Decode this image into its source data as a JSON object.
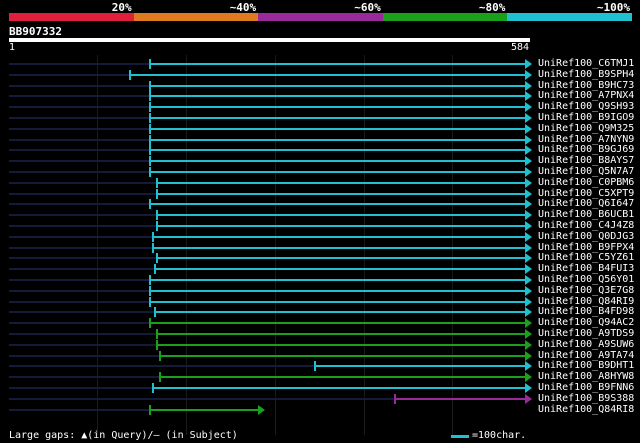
{
  "legend": {
    "labels": [
      "20%",
      "~40%",
      "~60%",
      "~80%",
      "~100%"
    ],
    "colors": [
      "#e0203a",
      "#e07a20",
      "#9a2a9a",
      "#1aa01a",
      "#20c0d0"
    ]
  },
  "query": {
    "id": "BB907332",
    "start": "1",
    "end": "584",
    "length": 584
  },
  "hits": [
    {
      "name": "UniRef100_C6TMJ1",
      "start": 160,
      "end": 584,
      "color": "#20c0d0"
    },
    {
      "name": "UniRef100_B9SPH4",
      "start": 137,
      "end": 584,
      "color": "#20c0d0"
    },
    {
      "name": "UniRef100_B9HC73",
      "start": 160,
      "end": 584,
      "color": "#20c0d0"
    },
    {
      "name": "UniRef100_A7PNX4",
      "start": 160,
      "end": 584,
      "color": "#20c0d0"
    },
    {
      "name": "UniRef100_Q9SH93",
      "start": 160,
      "end": 584,
      "color": "#20c0d0"
    },
    {
      "name": "UniRef100_B9IGO9",
      "start": 160,
      "end": 584,
      "color": "#20c0d0"
    },
    {
      "name": "UniRef100_Q9M325",
      "start": 160,
      "end": 584,
      "color": "#20c0d0"
    },
    {
      "name": "UniRef100_A7NYN9",
      "start": 160,
      "end": 584,
      "color": "#20c0d0"
    },
    {
      "name": "UniRef100_B9GJ69",
      "start": 160,
      "end": 584,
      "color": "#20c0d0"
    },
    {
      "name": "UniRef100_B8AYS7",
      "start": 160,
      "end": 584,
      "color": "#20c0d0"
    },
    {
      "name": "UniRef100_Q5N7A7",
      "start": 160,
      "end": 584,
      "color": "#20c0d0"
    },
    {
      "name": "UniRef100_C0PBM6",
      "start": 168,
      "end": 584,
      "color": "#20c0d0"
    },
    {
      "name": "UniRef100_C5XPT9",
      "start": 168,
      "end": 584,
      "color": "#20c0d0"
    },
    {
      "name": "UniRef100_Q6I647",
      "start": 160,
      "end": 584,
      "color": "#20c0d0"
    },
    {
      "name": "UniRef100_B6UCB1",
      "start": 168,
      "end": 584,
      "color": "#20c0d0"
    },
    {
      "name": "UniRef100_C4J4Z8",
      "start": 168,
      "end": 584,
      "color": "#20c0d0"
    },
    {
      "name": "UniRef100_Q0DJG3",
      "start": 163,
      "end": 584,
      "color": "#20c0d0"
    },
    {
      "name": "UniRef100_B9FPX4",
      "start": 163,
      "end": 584,
      "color": "#20c0d0"
    },
    {
      "name": "UniRef100_C5YZ61",
      "start": 168,
      "end": 584,
      "color": "#20c0d0"
    },
    {
      "name": "UniRef100_B4FUI3",
      "start": 165,
      "end": 584,
      "color": "#20c0d0"
    },
    {
      "name": "UniRef100_Q56Y01",
      "start": 160,
      "end": 584,
      "color": "#20c0d0"
    },
    {
      "name": "UniRef100_Q3E7G8",
      "start": 160,
      "end": 584,
      "color": "#20c0d0"
    },
    {
      "name": "UniRef100_Q84RI9",
      "start": 160,
      "end": 584,
      "color": "#20c0d0"
    },
    {
      "name": "UniRef100_B4FD98",
      "start": 165,
      "end": 584,
      "color": "#20c0d0"
    },
    {
      "name": "UniRef100_Q94AC2",
      "start": 160,
      "end": 584,
      "color": "#1aa01a"
    },
    {
      "name": "UniRef100_A9TDS9",
      "start": 168,
      "end": 584,
      "color": "#1aa01a"
    },
    {
      "name": "UniRef100_A9SUW6",
      "start": 168,
      "end": 584,
      "color": "#1aa01a"
    },
    {
      "name": "UniRef100_A9TA74",
      "start": 171,
      "end": 584,
      "color": "#1aa01a"
    },
    {
      "name": "UniRef100_B9DHT1",
      "start": 345,
      "end": 584,
      "color": "#20c0d0"
    },
    {
      "name": "UniRef100_A8HYW8",
      "start": 171,
      "end": 584,
      "color": "#1aa01a"
    },
    {
      "name": "UniRef100_B9FNN6",
      "start": 163,
      "end": 584,
      "color": "#20c0d0"
    },
    {
      "name": "UniRef100_B9S388",
      "start": 435,
      "end": 584,
      "color": "#9a2a9a"
    },
    {
      "name": "UniRef100_Q84RI8",
      "start": 160,
      "end": 283,
      "color": "#1aa01a"
    }
  ],
  "footer": {
    "gaps_text": "Large gaps: ▲(in Query)/– (in Subject)",
    "scale_text": "=100char."
  }
}
